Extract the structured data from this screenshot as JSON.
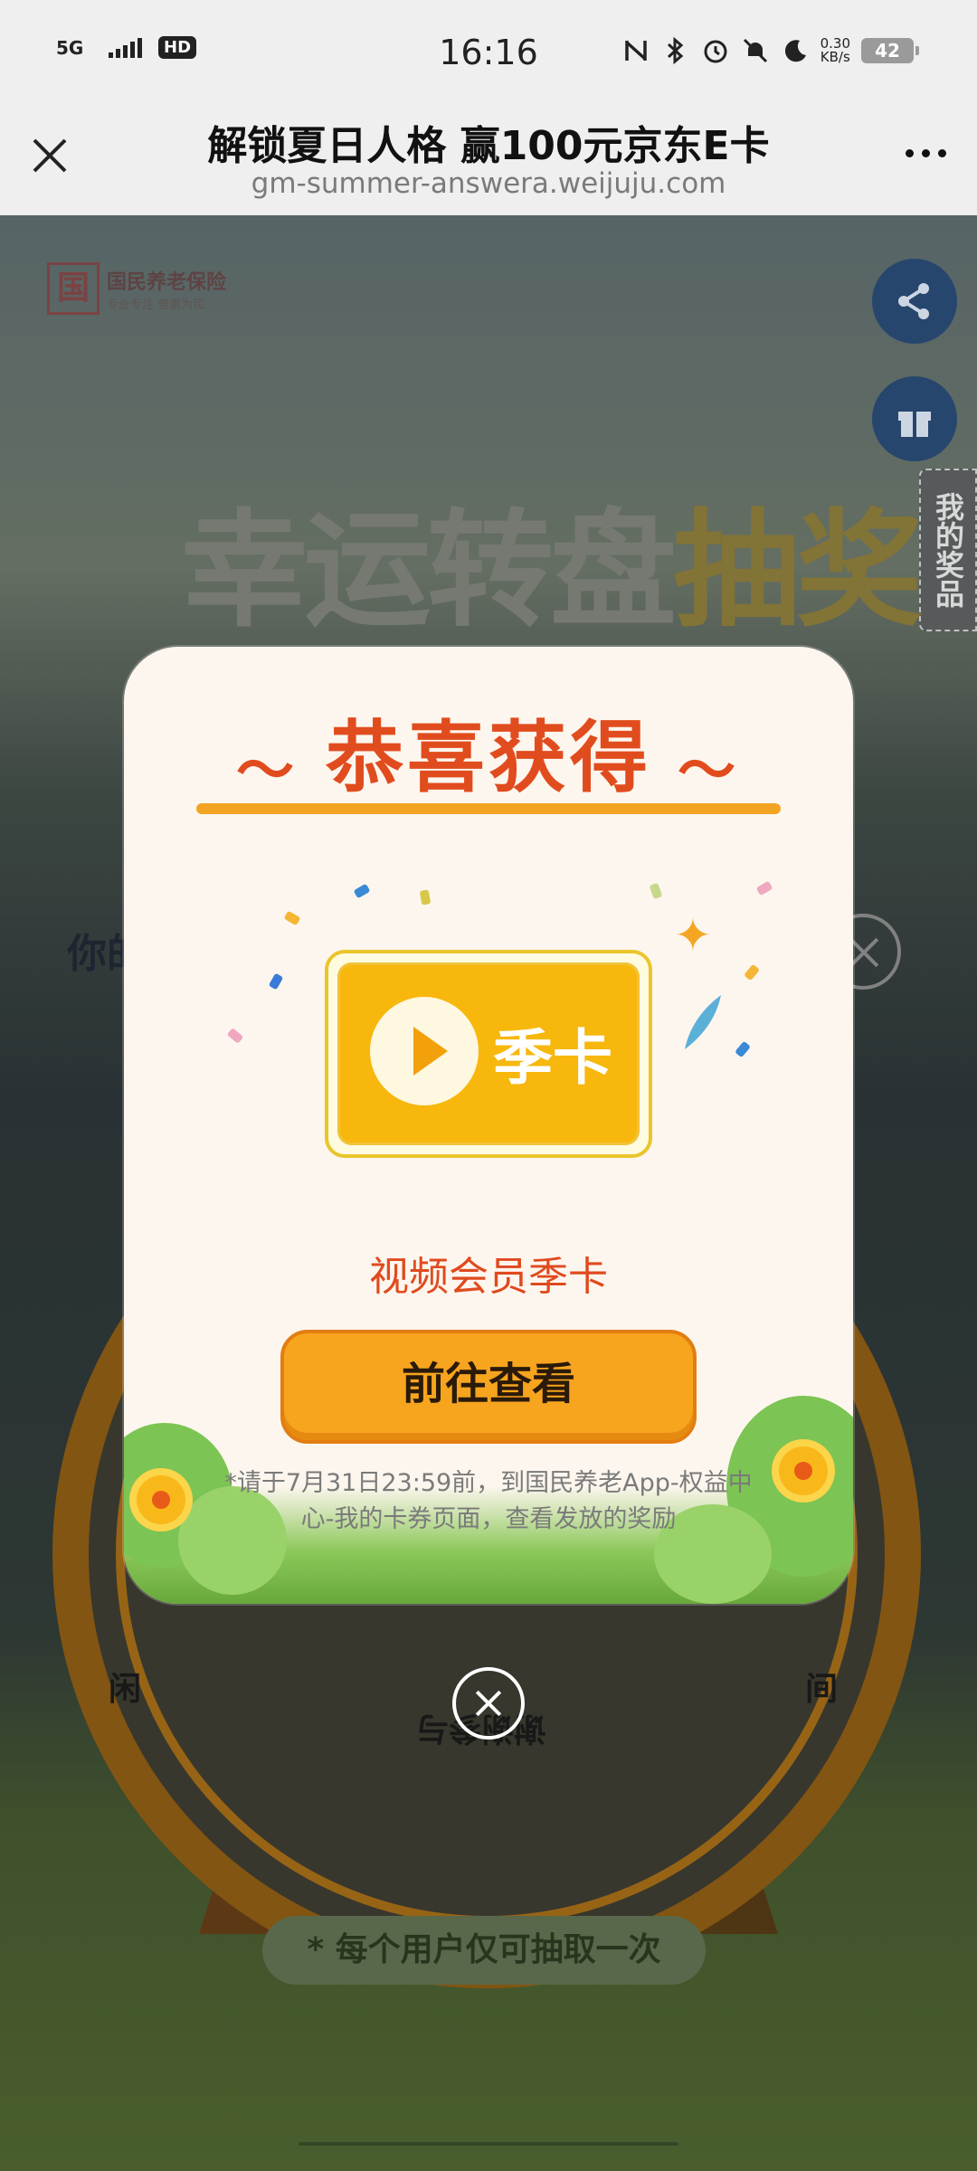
{
  "status_bar": {
    "network": "5G",
    "hd": "HD",
    "time": "16:16",
    "net_speed_value": "0.30",
    "net_speed_unit": "KB/s",
    "battery": "42"
  },
  "browser": {
    "title": "解锁夏日人格 赢100元京东E卡",
    "url": "gm-summer-answera.weijuju.com"
  },
  "background": {
    "logo_mark": "国",
    "logo_name": "国民养老保险",
    "logo_slogan": "专业专注 普惠为民",
    "my_prizes": "我的奖品",
    "headline_main": "幸运转盘",
    "headline_highlight": "抽奖",
    "you_label": "你的",
    "wheel_segment_bottom": "谢谢参与",
    "wheel_segment_left": "闲",
    "wheel_segment_right": "间",
    "rule_text": "* 每个用户仅可抽取一次"
  },
  "popup": {
    "title": "恭喜获得",
    "card_label": "季卡",
    "prize_name": "视频会员季卡",
    "button_label": "前往查看",
    "note": "*请于7月31日23:59前，到国民养老App-权益中心-我的卡券页面，查看发放的奖励"
  },
  "colors": {
    "accent_red": "#e14c1e",
    "accent_orange": "#f7a41e",
    "card_yellow": "#f7b70c"
  }
}
